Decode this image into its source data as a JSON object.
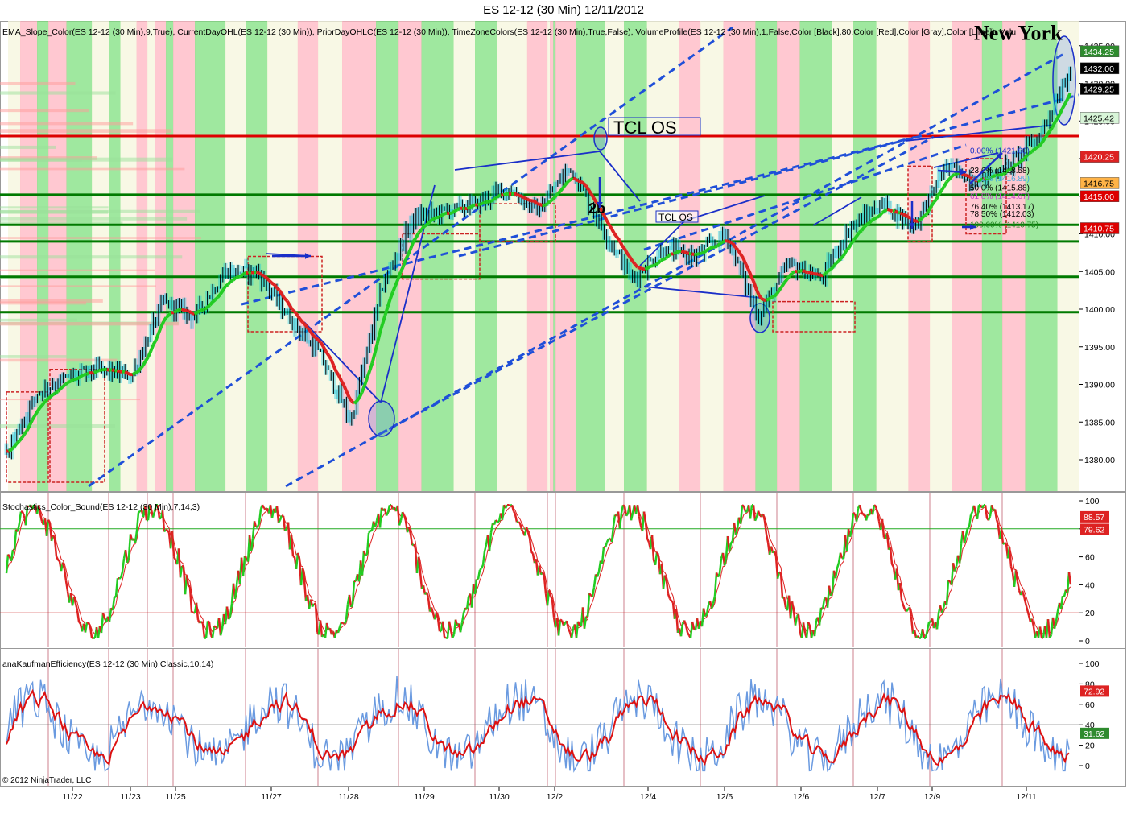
{
  "window": {
    "title": "ES 12-12 (30 Min)  12/11/2012"
  },
  "copyright": "© 2012 NinjaTrader, LLC",
  "colors": {
    "up": "#22cc22",
    "down": "#dd2222",
    "zone_green": "#7fe07f",
    "zone_pink": "#ffb6c1",
    "zone_cream": "#f5f5dc",
    "trend_blue": "#1f4fd8",
    "support_green": "#007a00",
    "resistance_red": "#dd0000"
  },
  "chart_data": [
    {
      "type": "line",
      "name": "price-panel",
      "indicator_label": "EMA_Slope_Color(ES 12-12 (30 Min),9,True), CurrentDayOHL(ES 12-12 (30 Min)), PriorDayOHLC(ES 12-12 (30 Min)), TimeZoneColors(ES 12-12 (30 Min),True,False), VolumeProfile(ES 12-12 (30 Min),1,False,Color [Black],80,Color [Red],Color [Gray],Color [Lime]), Volu",
      "ylim": [
        1376,
        1440
      ],
      "yticks": [
        "1435.00",
        "1430.00",
        "1425.00",
        "1420.00",
        "1415.00",
        "1410.00",
        "1405.00",
        "1400.00",
        "1395.00",
        "1390.00",
        "1385.00",
        "1380.00"
      ],
      "x_dates": [
        "11/22",
        "11/23",
        "11/25",
        "11/27",
        "11/28",
        "11/29",
        "11/30",
        "12/2",
        "12/4",
        "12/5",
        "12/6",
        "12/7",
        "12/9",
        "12/11"
      ],
      "series": [
        {
          "x": [
            "11/21",
            "11/22",
            "11/22",
            "11/23",
            "11/25",
            "11/26",
            "11/26",
            "11/27",
            "11/27",
            "11/28",
            "11/28",
            "11/28",
            "11/29",
            "11/29",
            "11/29",
            "11/30",
            "11/30",
            "12/2",
            "12/3",
            "12/3",
            "12/4",
            "12/4",
            "12/5",
            "12/5",
            "12/5",
            "12/6",
            "12/6",
            "12/7",
            "12/7",
            "12/7",
            "12/9",
            "12/10",
            "12/10",
            "12/11",
            "12/11"
          ],
          "values": [
            1381,
            1389,
            1391,
            1392,
            1391,
            1401,
            1399,
            1405,
            1405,
            1399,
            1394,
            1385,
            1403,
            1412,
            1413,
            1414,
            1416,
            1413,
            1419,
            1411,
            1404,
            1408,
            1407,
            1410,
            1399,
            1406,
            1404,
            1411,
            1414,
            1411,
            1419,
            1417,
            1419,
            1423,
            1432
          ]
        }
      ],
      "price_badges": [
        {
          "text": "1434.25",
          "value": 1434.25,
          "bg": "#2e8b2e",
          "fg": "#ffffff"
        },
        {
          "text": "1432.00",
          "value": 1432.0,
          "bg": "#000000",
          "fg": "#ffffff"
        },
        {
          "text": "1429.25",
          "value": 1429.25,
          "bg": "#000000",
          "fg": "#ffffff"
        },
        {
          "text": "1425.42",
          "value": 1425.42,
          "bg": "#d8f5d8",
          "fg": "#000000"
        },
        {
          "text": "1420.25",
          "value": 1420.25,
          "bg": "#dd2222",
          "fg": "#ffffff"
        },
        {
          "text": "1416.75",
          "value": 1416.75,
          "bg": "#ffb347",
          "fg": "#000000"
        },
        {
          "text": "1415.00",
          "value": 1415.0,
          "bg": "#dd0000",
          "fg": "#ffffff"
        },
        {
          "text": "1410.75",
          "value": 1410.75,
          "bg": "#dd0000",
          "fg": "#ffffff"
        }
      ],
      "horizontal_levels": [
        {
          "value": 1423.0,
          "color": "#dd0000"
        },
        {
          "value": 1415.2,
          "color": "#007a00"
        },
        {
          "value": 1411.2,
          "color": "#007a00"
        },
        {
          "value": 1409.0,
          "color": "#007a00"
        },
        {
          "value": 1404.3,
          "color": "#007a00"
        },
        {
          "value": 1399.6,
          "color": "#007a00"
        }
      ],
      "annotations": [
        {
          "text": "New York",
          "value": 1436
        },
        {
          "text": "TCL OS",
          "value": 1423.5
        },
        {
          "text": "TCL OS",
          "value": 1410.3
        },
        {
          "text": "2b",
          "value": 1412.5
        }
      ],
      "fib_labels": [
        {
          "text": "0.00% (1421.00)",
          "value": 1421.0
        },
        {
          "text": "23.6% (1418.58)",
          "value": 1418.4
        },
        {
          "text": "38.2% (1416.89)",
          "value": 1417.3
        },
        {
          "text": "50.0% (1415.88)",
          "value": 1416.1
        },
        {
          "text": "61.8% (1414.67)",
          "value": 1415.0
        },
        {
          "text": "76.40% (1413.17)",
          "value": 1413.6
        },
        {
          "text": "78.50% (1412.03)",
          "value": 1412.6
        },
        {
          "text": "100.00% (1410.75)",
          "value": 1411.2
        }
      ]
    },
    {
      "type": "line",
      "name": "stochastics-panel",
      "indicator_label": "Stochastics_Color_Sound(ES 12-12 (30 Min),7,14,3)",
      "ylim": [
        -5,
        105
      ],
      "yticks": [
        "100",
        "80",
        "60",
        "40",
        "20",
        "0"
      ],
      "levels": [
        80,
        20
      ],
      "badges": [
        {
          "text": "88.57",
          "value": 88.57,
          "bg": "#dd2222"
        },
        {
          "text": "79.62",
          "value": 79.62,
          "bg": "#dd2222"
        }
      ]
    },
    {
      "type": "line",
      "name": "kaufman-panel",
      "indicator_label": "anaKaufmanEfficiency(ES 12-12 (30 Min),Classic,10,14)",
      "ylim": [
        -12,
        108
      ],
      "yticks": [
        "100",
        "80",
        "60",
        "40",
        "20",
        "0"
      ],
      "levels": [
        40
      ],
      "badges": [
        {
          "text": "72.92",
          "value": 72.92,
          "bg": "#dd2222"
        },
        {
          "text": "31.62",
          "value": 31.62,
          "bg": "#2e8b2e"
        }
      ]
    }
  ]
}
